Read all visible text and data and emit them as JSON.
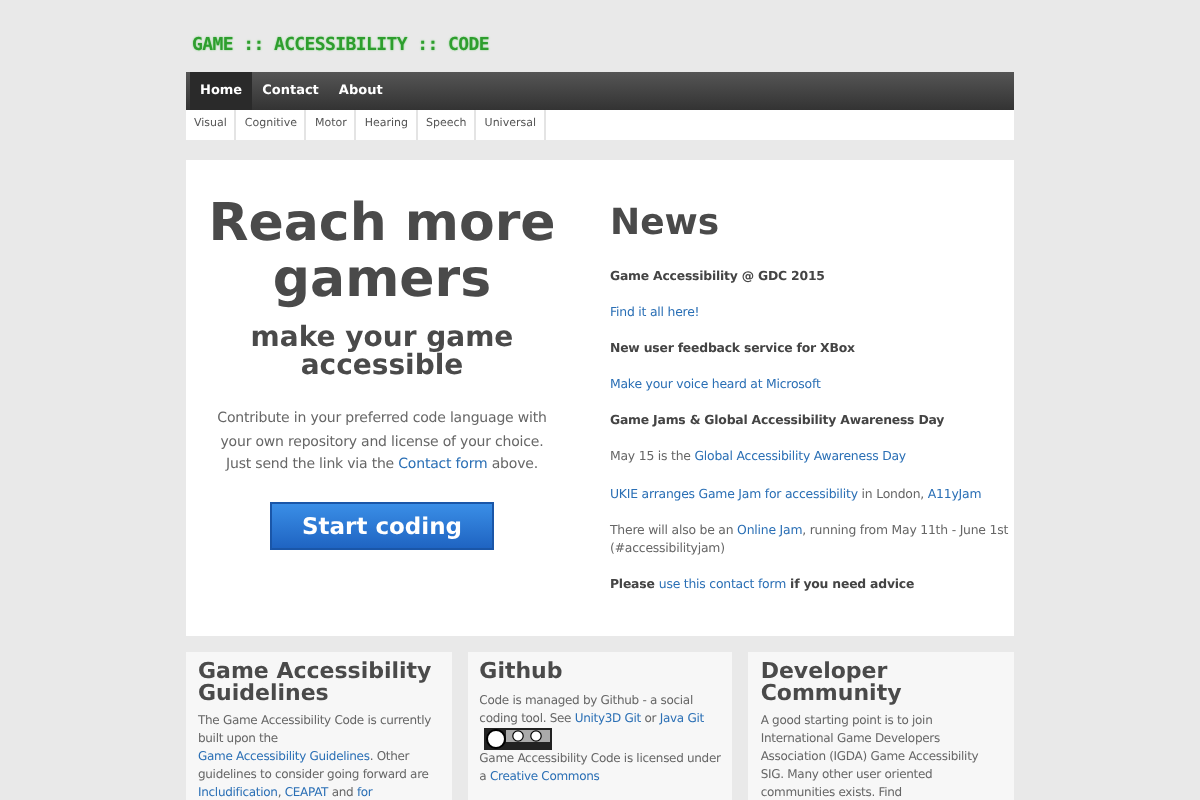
{
  "logo": "GAME :: ACCESSIBILITY :: CODE",
  "nav": [
    {
      "label": "Home",
      "selected": true
    },
    {
      "label": "Contact",
      "selected": false
    },
    {
      "label": "About",
      "selected": false
    }
  ],
  "subnav": [
    "Visual",
    "Cognitive",
    "Motor",
    "Hearing",
    "Speech",
    "Universal"
  ],
  "hero": {
    "title": "Reach more gamers",
    "subtitle": "make your game accessible",
    "text": [
      {
        "kind": "text",
        "text": "Contribute in your preferred code language with your own repository and license of your choice. Just send the link via the "
      },
      {
        "kind": "link",
        "text": "Contact form"
      },
      {
        "kind": "text",
        "text": " above."
      }
    ],
    "button": "Start coding"
  },
  "news": {
    "title": "News",
    "items": [
      [
        {
          "kind": "bold",
          "text": "Game Accessibility @ GDC 2015"
        }
      ],
      [
        {
          "kind": "link",
          "text": "Find it all here!"
        }
      ],
      [
        {
          "kind": "bold",
          "text": "New user feedback service for XBox"
        }
      ],
      [
        {
          "kind": "link",
          "text": "Make your voice heard at Microsoft"
        }
      ],
      [
        {
          "kind": "bold",
          "text": "Game Jams & Global Accessibility Awareness Day"
        }
      ],
      [
        {
          "kind": "text",
          "text": "May 15 is the "
        },
        {
          "kind": "link",
          "text": "Global Accessibility Awareness Day"
        }
      ],
      [
        {
          "kind": "link",
          "text": "UKIE arranges Game Jam for accessibility"
        },
        {
          "kind": "text",
          "text": " in London, "
        },
        {
          "kind": "link",
          "text": "A11yJam"
        }
      ],
      [
        {
          "kind": "text",
          "text": "There will also be an "
        },
        {
          "kind": "link",
          "text": "Online Jam"
        },
        {
          "kind": "text",
          "text": ", running from May 11th - June 1st (#accessibilityjam)"
        }
      ],
      [
        {
          "kind": "bold",
          "text": "Please "
        },
        {
          "kind": "link",
          "text": "use this contact form"
        },
        {
          "kind": "bold",
          "text": " if you need advice"
        }
      ]
    ]
  },
  "cards": [
    {
      "title": "Game Accessibility Guidelines",
      "paragraphs": [
        [
          {
            "kind": "text",
            "text": "The Game Accessibility Code is currently built upon the "
          },
          {
            "kind": "link",
            "text": "Game Accessibility Guidelines"
          },
          {
            "kind": "text",
            "text": ". Other guidelines to consider going forward are "
          },
          {
            "kind": "link",
            "text": "Includification"
          },
          {
            "kind": "text",
            "text": ", "
          },
          {
            "kind": "link",
            "text": "CEAPAT"
          },
          {
            "kind": "text",
            "text": " and "
          },
          {
            "kind": "link",
            "text": "for"
          }
        ]
      ]
    },
    {
      "title": "Github",
      "paragraphs": [
        [
          {
            "kind": "text",
            "text": "Code is managed by Github - a social coding tool. See "
          },
          {
            "kind": "link",
            "text": "Unity3D Git"
          },
          {
            "kind": "text",
            "text": " or "
          },
          {
            "kind": "link",
            "text": "Java Git"
          },
          {
            "kind": "badge"
          }
        ],
        [
          {
            "kind": "text",
            "text": "Game Accessibility Code is licensed under a "
          },
          {
            "kind": "link",
            "text": "Creative Commons"
          }
        ]
      ]
    },
    {
      "title": "Developer Community",
      "paragraphs": [
        [
          {
            "kind": "text",
            "text": "A good starting point is to join International Game Developers Association (IGDA) Game Accessibility SIG. Many other user oriented communities exists. Find"
          }
        ]
      ]
    }
  ]
}
